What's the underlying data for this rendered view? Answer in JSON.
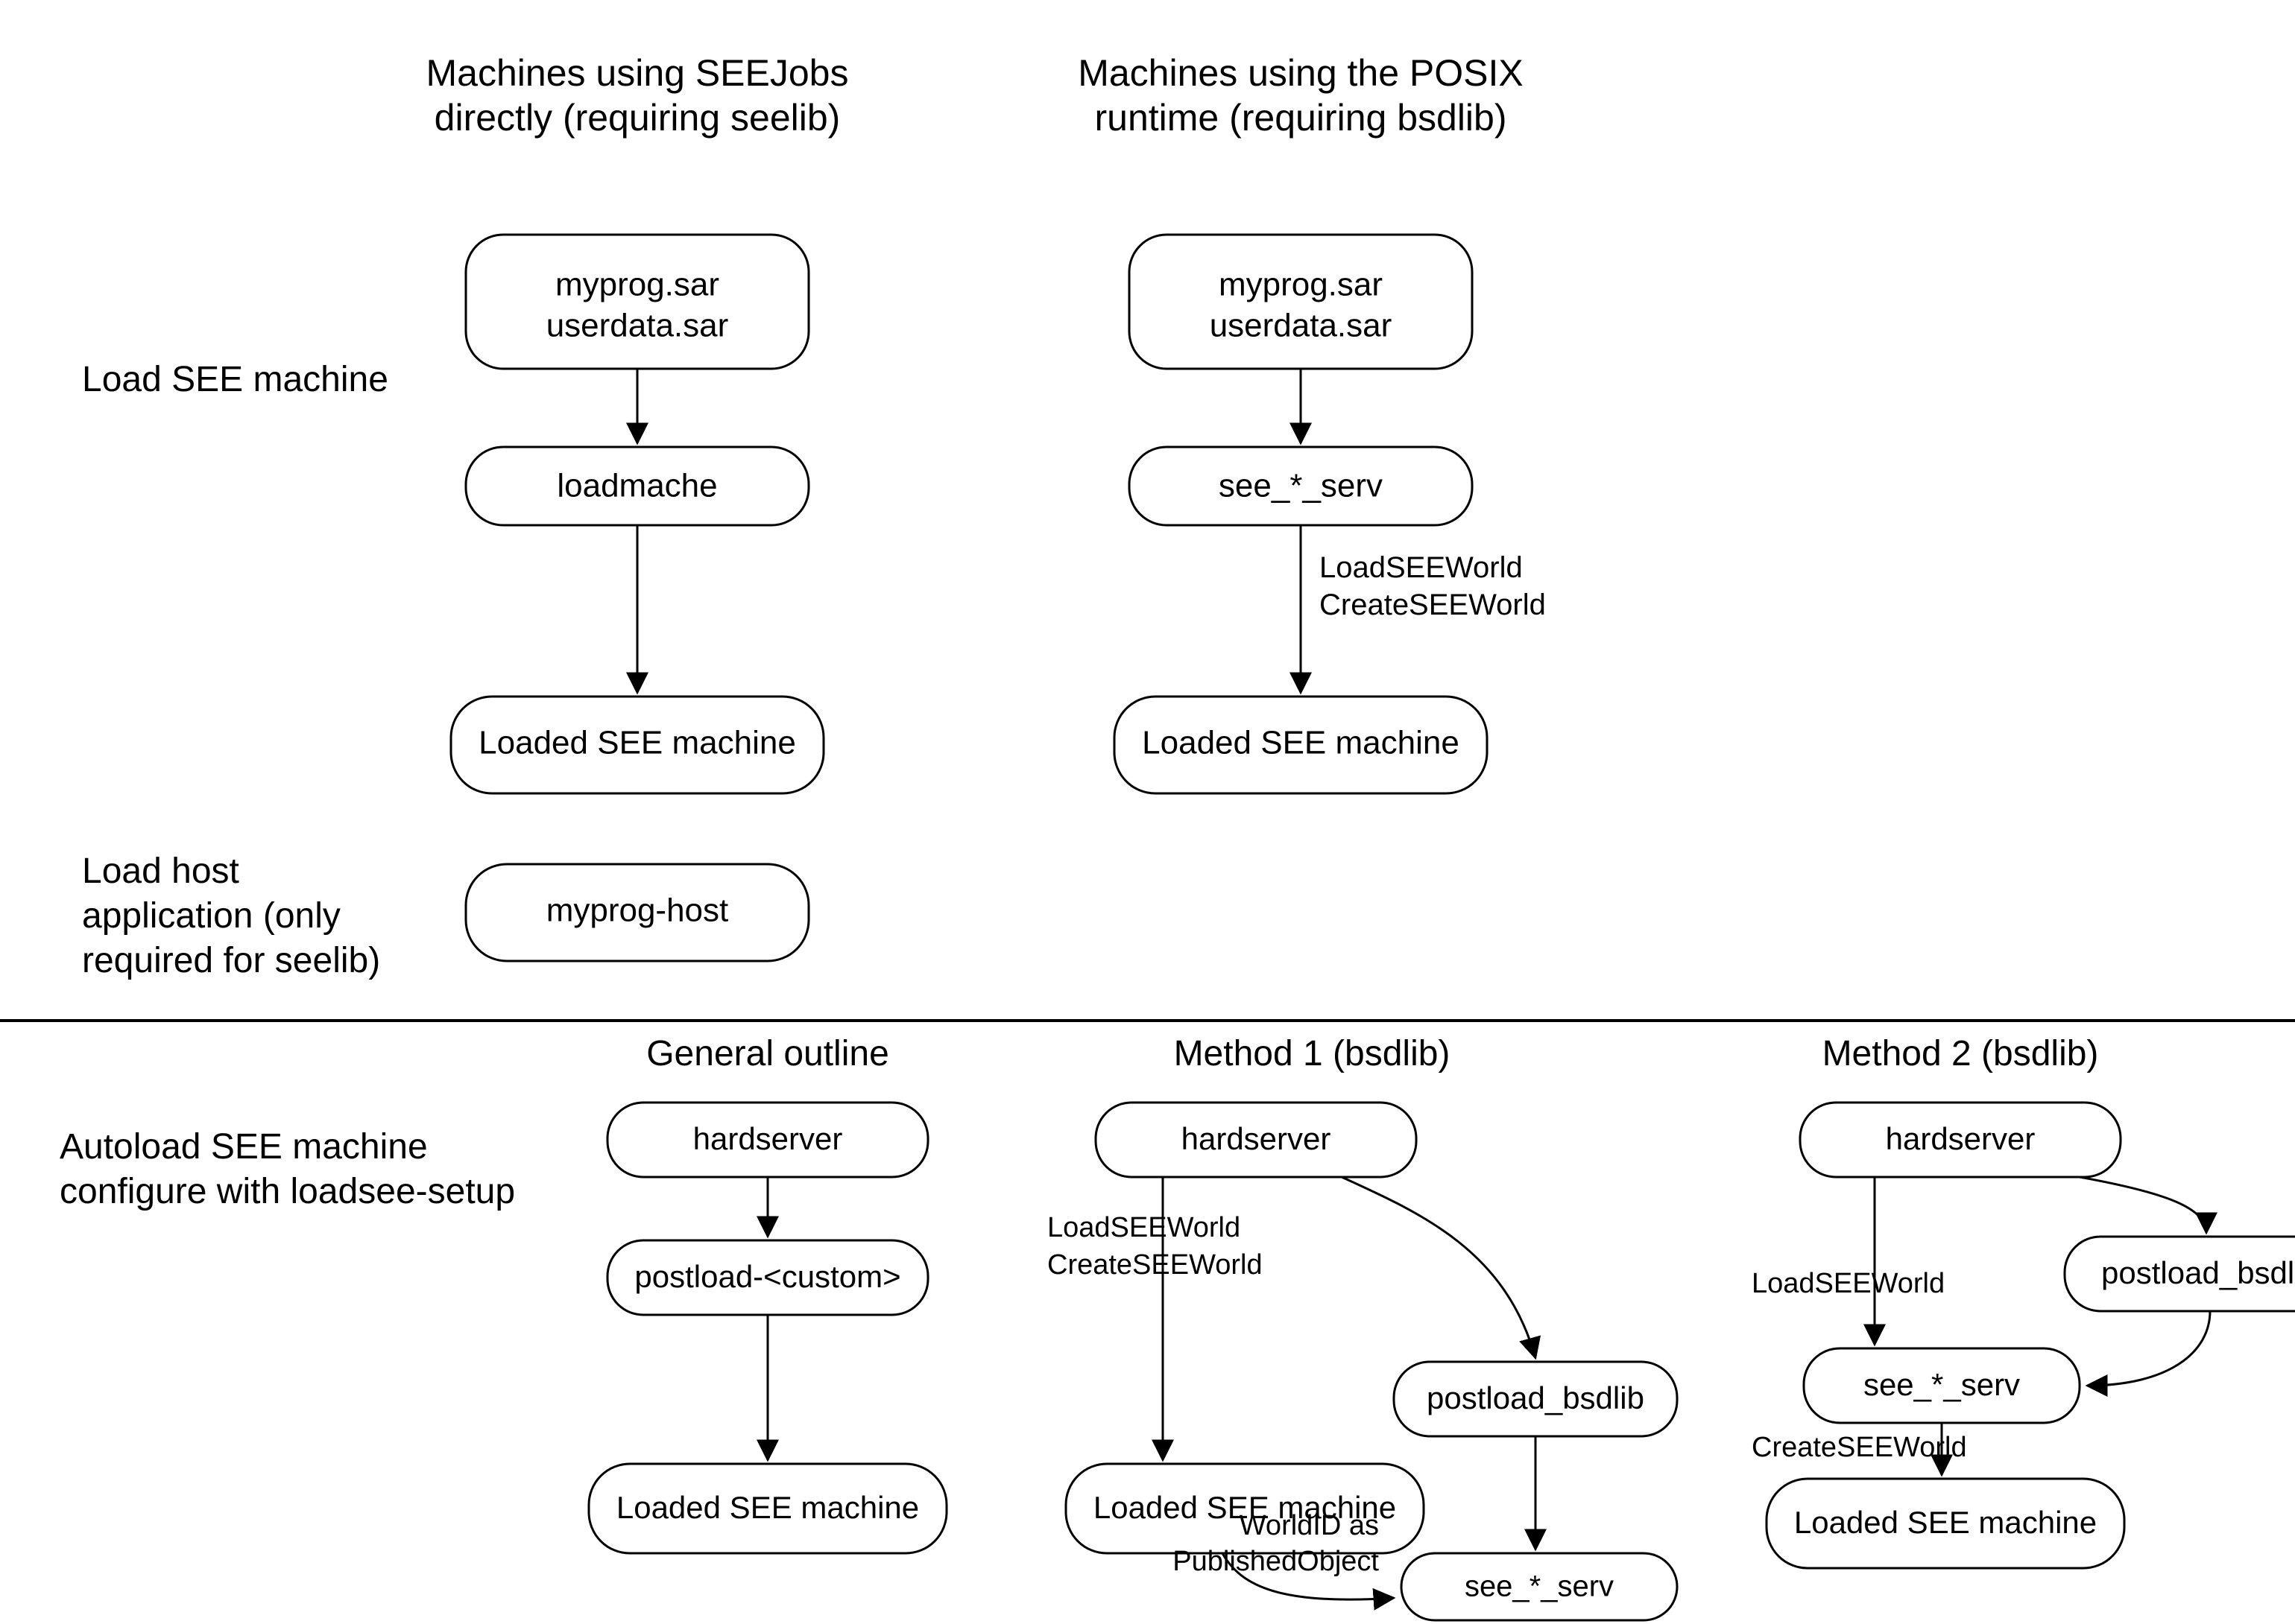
{
  "rowLabels": {
    "loadSee": "Load SEE machine",
    "loadHost1": "Load host",
    "loadHost2": "application (only",
    "loadHost3": "required for seelib)",
    "autoload1": "Autoload SEE machine",
    "autoload2": "configure with loadsee-setup"
  },
  "colHeaders": {
    "seejobs1": "Machines using SEEJobs",
    "seejobs2": "directly (requiring seelib)",
    "posix1": "Machines using the POSIX",
    "posix2": "runtime (requiring bsdlib)",
    "general": "General outline",
    "method1": "Method 1 (bsdlib)",
    "method2": "Method 2 (bsdlib)"
  },
  "nodes": {
    "sar1a": "myprog.sar",
    "sar1b": "userdata.sar",
    "loadmache": "loadmache",
    "loaded": "Loaded SEE machine",
    "myprogHost": "myprog-host",
    "sar2a": "myprog.sar",
    "sar2b": "userdata.sar",
    "seeServ": "see_*_serv",
    "hardserver": "hardserver",
    "postloadCustom": "postload-<custom>",
    "postloadBsdlib": "postload_bsdlib"
  },
  "edgeLabels": {
    "loadSeeWorld": "LoadSEEWorld",
    "createSeeWorld": "CreateSEEWorld",
    "worldId1": "WorldID as",
    "worldId2": "PublishedObject"
  }
}
